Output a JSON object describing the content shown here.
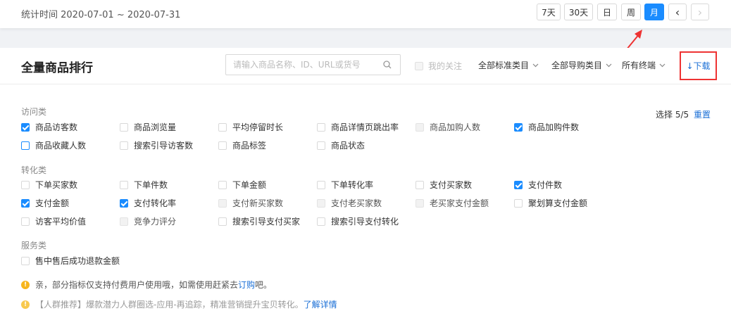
{
  "header": {
    "period_label": "统计时间 2020-07-01 ~ 2020-07-31",
    "periods": [
      "7天",
      "30天",
      "日",
      "周",
      "月"
    ],
    "active_period": "月",
    "prev_label": "‹",
    "next_label": "›"
  },
  "panel": {
    "title": "全量商品排行",
    "search_placeholder": "请输入商品名称、ID、URL或货号",
    "my_follow_label": "我的关注",
    "dropdowns": [
      "全部标准类目",
      "全部导购类目",
      "所有终端"
    ],
    "download_label": "↓下载",
    "select_count": "选择 5/5",
    "reset_label": "重置"
  },
  "groups": {
    "visit": {
      "label": "访问类",
      "options": [
        {
          "label": "商品访客数",
          "state": "checked"
        },
        {
          "label": "商品浏览量",
          "state": "unchecked"
        },
        {
          "label": "平均停留时长",
          "state": "unchecked"
        },
        {
          "label": "商品详情页跳出率",
          "state": "unchecked"
        },
        {
          "label": "商品加购人数",
          "state": "disabled"
        },
        {
          "label": "商品加购件数",
          "state": "checked"
        },
        {
          "label": "商品收藏人数",
          "state": "focus"
        },
        {
          "label": "搜索引导访客数",
          "state": "unchecked"
        },
        {
          "label": "商品标签",
          "state": "unchecked"
        },
        {
          "label": "商品状态",
          "state": "unchecked"
        }
      ]
    },
    "convert": {
      "label": "转化类",
      "options": [
        {
          "label": "下单买家数",
          "state": "unchecked"
        },
        {
          "label": "下单件数",
          "state": "unchecked"
        },
        {
          "label": "下单金额",
          "state": "unchecked"
        },
        {
          "label": "下单转化率",
          "state": "unchecked"
        },
        {
          "label": "支付买家数",
          "state": "unchecked"
        },
        {
          "label": "支付件数",
          "state": "checked"
        },
        {
          "label": "支付金额",
          "state": "checked"
        },
        {
          "label": "支付转化率",
          "state": "checked"
        },
        {
          "label": "支付新买家数",
          "state": "disabled"
        },
        {
          "label": "支付老买家数",
          "state": "disabled"
        },
        {
          "label": "老买家支付金额",
          "state": "disabled"
        },
        {
          "label": "聚划算支付金额",
          "state": "unchecked"
        },
        {
          "label": "访客平均价值",
          "state": "unchecked"
        },
        {
          "label": "竞争力评分",
          "state": "disabled"
        },
        {
          "label": "搜索引导支付买家",
          "state": "unchecked"
        },
        {
          "label": "搜索引导支付转化",
          "state": "unchecked"
        }
      ]
    },
    "service": {
      "label": "服务类",
      "options": [
        {
          "label": "售中售后成功退款金额",
          "state": "unchecked"
        }
      ]
    }
  },
  "notices": {
    "n1_prefix": "亲，部分指标仅支持付费用户使用哦，如需使用赶紧去",
    "n1_link": "订购",
    "n1_suffix": "吧。",
    "n2_text": "【人群推荐】爆款潜力人群圈选-应用-再追踪，精准营销提升宝贝转化。",
    "n2_link": "了解详情"
  },
  "colors": {
    "accent": "#1a8cff",
    "link": "#1a6fd6",
    "highlight_box": "#e33",
    "warning": "#f7b51c"
  }
}
